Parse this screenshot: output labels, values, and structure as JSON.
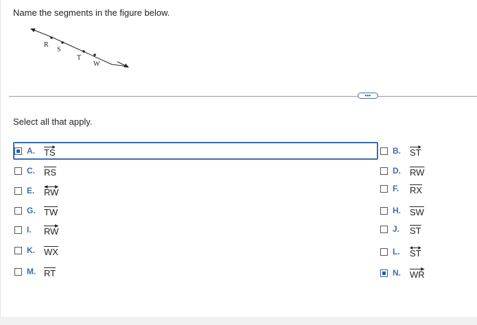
{
  "question": {
    "prompt": "Name the segments in the figure below.",
    "instruction": "Select all that apply."
  },
  "figure": {
    "points": [
      "R",
      "S",
      "T",
      "W"
    ]
  },
  "more_button": {
    "label": "•••"
  },
  "options": [
    {
      "letter": "A.",
      "label": "TS",
      "notation": "ray",
      "checked": true,
      "focused": true
    },
    {
      "letter": "B.",
      "label": "ST",
      "notation": "ray",
      "checked": false
    },
    {
      "letter": "C.",
      "label": "RS",
      "notation": "segment",
      "checked": false
    },
    {
      "letter": "D.",
      "label": "RW",
      "notation": "segment",
      "checked": false
    },
    {
      "letter": "E.",
      "label": "RW",
      "notation": "line",
      "checked": false
    },
    {
      "letter": "F.",
      "label": "RX",
      "notation": "segment",
      "checked": false
    },
    {
      "letter": "G.",
      "label": "TW",
      "notation": "segment",
      "checked": false
    },
    {
      "letter": "H.",
      "label": "SW",
      "notation": "segment",
      "checked": false
    },
    {
      "letter": "I.",
      "label": "RW",
      "notation": "ray",
      "checked": false
    },
    {
      "letter": "J.",
      "label": "ST",
      "notation": "segment",
      "checked": false
    },
    {
      "letter": "K.",
      "label": "WX",
      "notation": "segment",
      "checked": false
    },
    {
      "letter": "L.",
      "label": "ST",
      "notation": "line",
      "checked": false
    },
    {
      "letter": "M.",
      "label": "RT",
      "notation": "segment",
      "checked": false
    },
    {
      "letter": "N.",
      "label": "WR",
      "notation": "ray",
      "checked": true
    }
  ],
  "colors": {
    "accent": "#3d6bb0",
    "focus_border": "#3a6bb5"
  }
}
